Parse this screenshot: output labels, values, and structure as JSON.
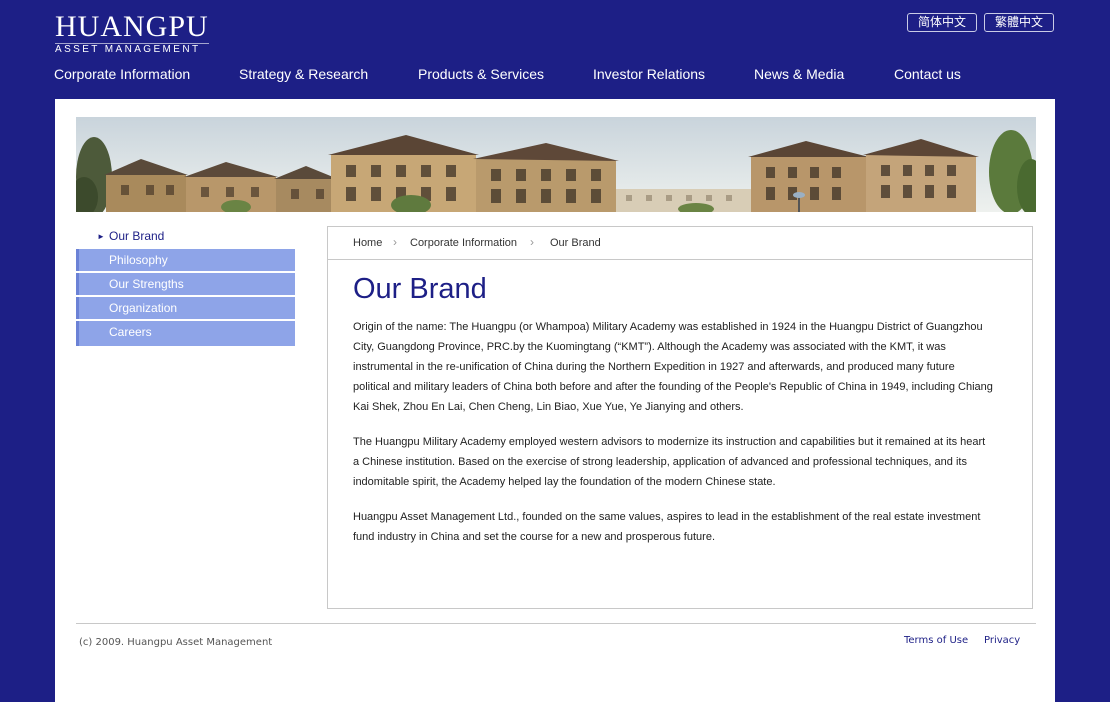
{
  "logo": {
    "title": "HUANGPU",
    "subtitle": "ASSET MANAGEMENT"
  },
  "language": {
    "simplified": "简体中文",
    "traditional": "繁體中文"
  },
  "nav": [
    {
      "label": "Corporate Information"
    },
    {
      "label": "Strategy & Research"
    },
    {
      "label": "Products & Services"
    },
    {
      "label": "Investor Relations"
    },
    {
      "label": "News & Media"
    },
    {
      "label": "Contact us"
    }
  ],
  "sidebar": {
    "active": "Our Brand",
    "items": [
      {
        "label": "Philosophy"
      },
      {
        "label": "Our Strengths"
      },
      {
        "label": "Organization"
      },
      {
        "label": "Careers"
      }
    ]
  },
  "breadcrumb": [
    {
      "label": "Home"
    },
    {
      "label": "Corporate Information"
    },
    {
      "label": "Our Brand"
    }
  ],
  "main": {
    "title": "Our Brand",
    "paragraphs": [
      "Origin of the name: The Huangpu (or Whampoa) Military Academy was established in 1924 in the Huangpu District of Guangzhou City, Guangdong Province, PRC.by the Kuomingtang (“KMT”). Although the Academy was associated with the KMT, it was instrumental in the re-unification of China during the Northern Expedition in 1927 and afterwards, and produced many future political and military leaders of China both before and after the founding of the People's Republic of China in 1949, including Chiang Kai Shek, Zhou En Lai, Chen Cheng, Lin Biao, Xue Yue, Ye Jianying and others.",
      "The Huangpu Military Academy employed western advisors to modernize its instruction and capabilities but it remained at its heart a Chinese institution. Based on the exercise of strong leadership, application of advanced and professional techniques, and its indomitable spirit, the Academy helped lay the foundation of the modern Chinese state.",
      "Huangpu Asset Management Ltd., founded on the same values, aspires to lead in the establishment of the real estate investment fund industry in China and set the course for a new and prosperous future."
    ]
  },
  "footer": {
    "copyright": "(c) 2009. Huangpu Asset Management",
    "terms": "Terms of Use",
    "privacy": "Privacy"
  },
  "colors": {
    "brand": "#1d1f86",
    "sidebar": "#8ea4e8",
    "content_bg": "#ffffff"
  }
}
